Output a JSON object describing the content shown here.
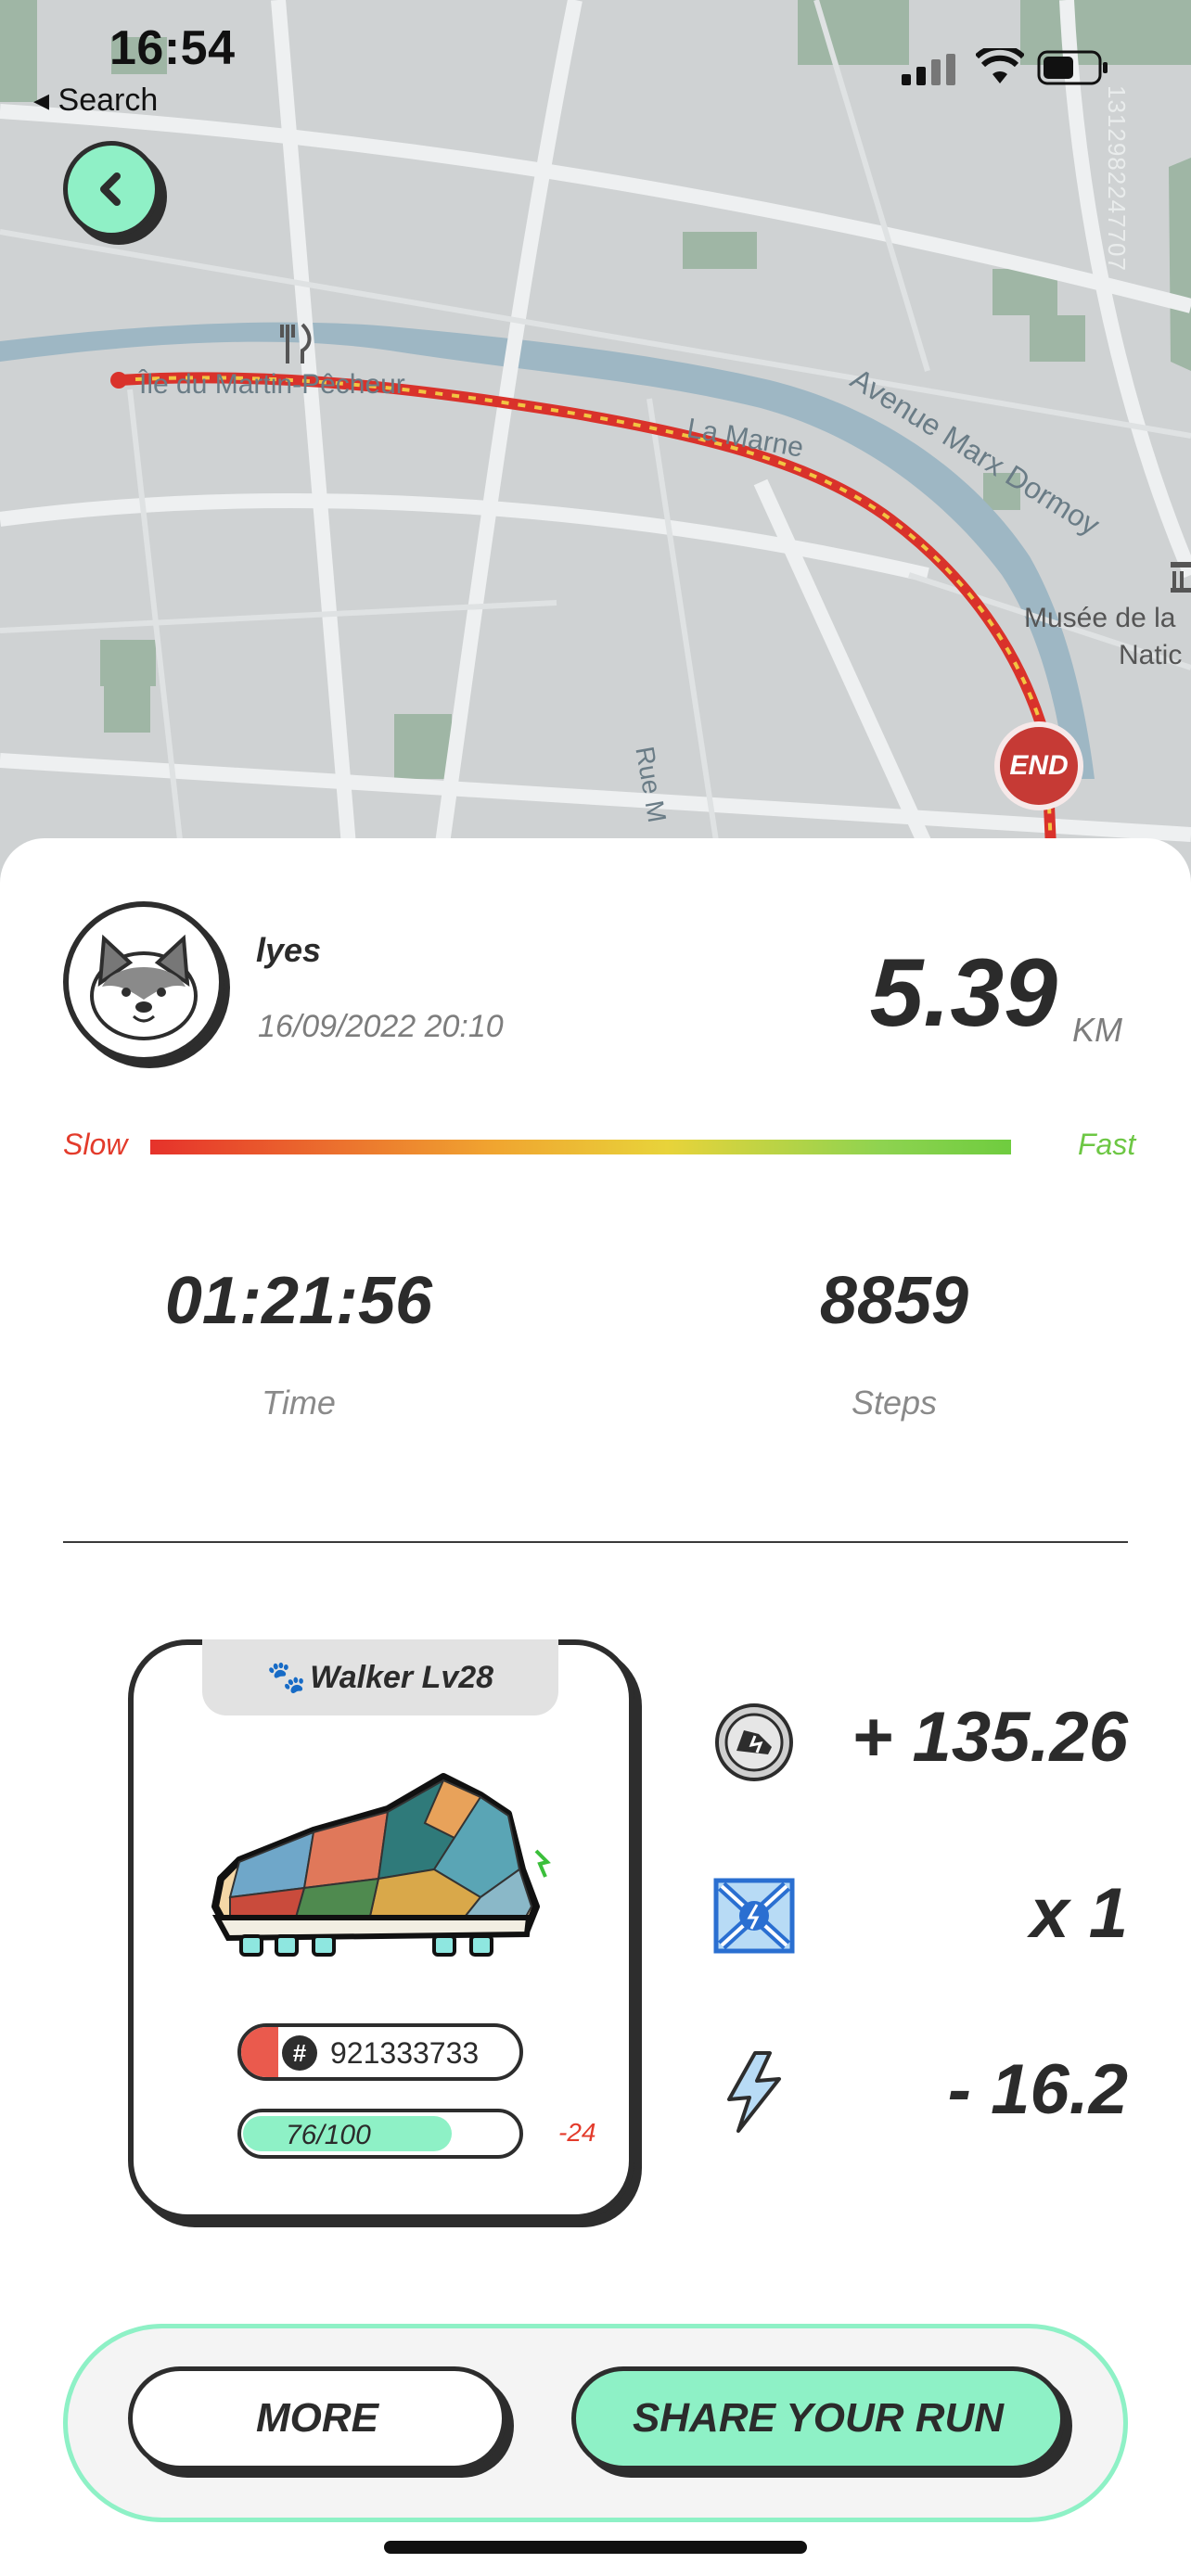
{
  "status_bar": {
    "time": "16:54",
    "back_label": "◂ Search"
  },
  "map": {
    "id_code": "1312982247707",
    "labels": {
      "street1": "Avenue Marx Dormoy",
      "street2": "Rue M",
      "river": "La Marne",
      "island": "Île du Martin-Pêcheur",
      "museum": "Musée de la",
      "museum2": "Natic"
    },
    "end_label": "END"
  },
  "run": {
    "username": "lyes",
    "datetime": "16/09/2022 20:10",
    "distance": "5.39",
    "distance_unit": "KM",
    "speed_slow": "Slow",
    "speed_fast": "Fast",
    "time_value": "01:21:56",
    "time_label": "Time",
    "steps_value": "8859",
    "steps_label": "Steps"
  },
  "sneaker": {
    "title": "Walker Lv28",
    "id": "921333733",
    "durability_text": "76/100",
    "durability_fraction": 0.76,
    "durability_delta": "-24"
  },
  "rewards": {
    "token": "+ 135.26",
    "mystery_box": "x 1",
    "energy": "- 16.2"
  },
  "actions": {
    "more": "MORE",
    "share": "SHARE YOUR RUN"
  },
  "colors": {
    "accent": "#8ef1c6",
    "route": "#d9322b",
    "dark": "#2d2d2d",
    "slow": "#e33b2b",
    "fast": "#6dc744"
  }
}
